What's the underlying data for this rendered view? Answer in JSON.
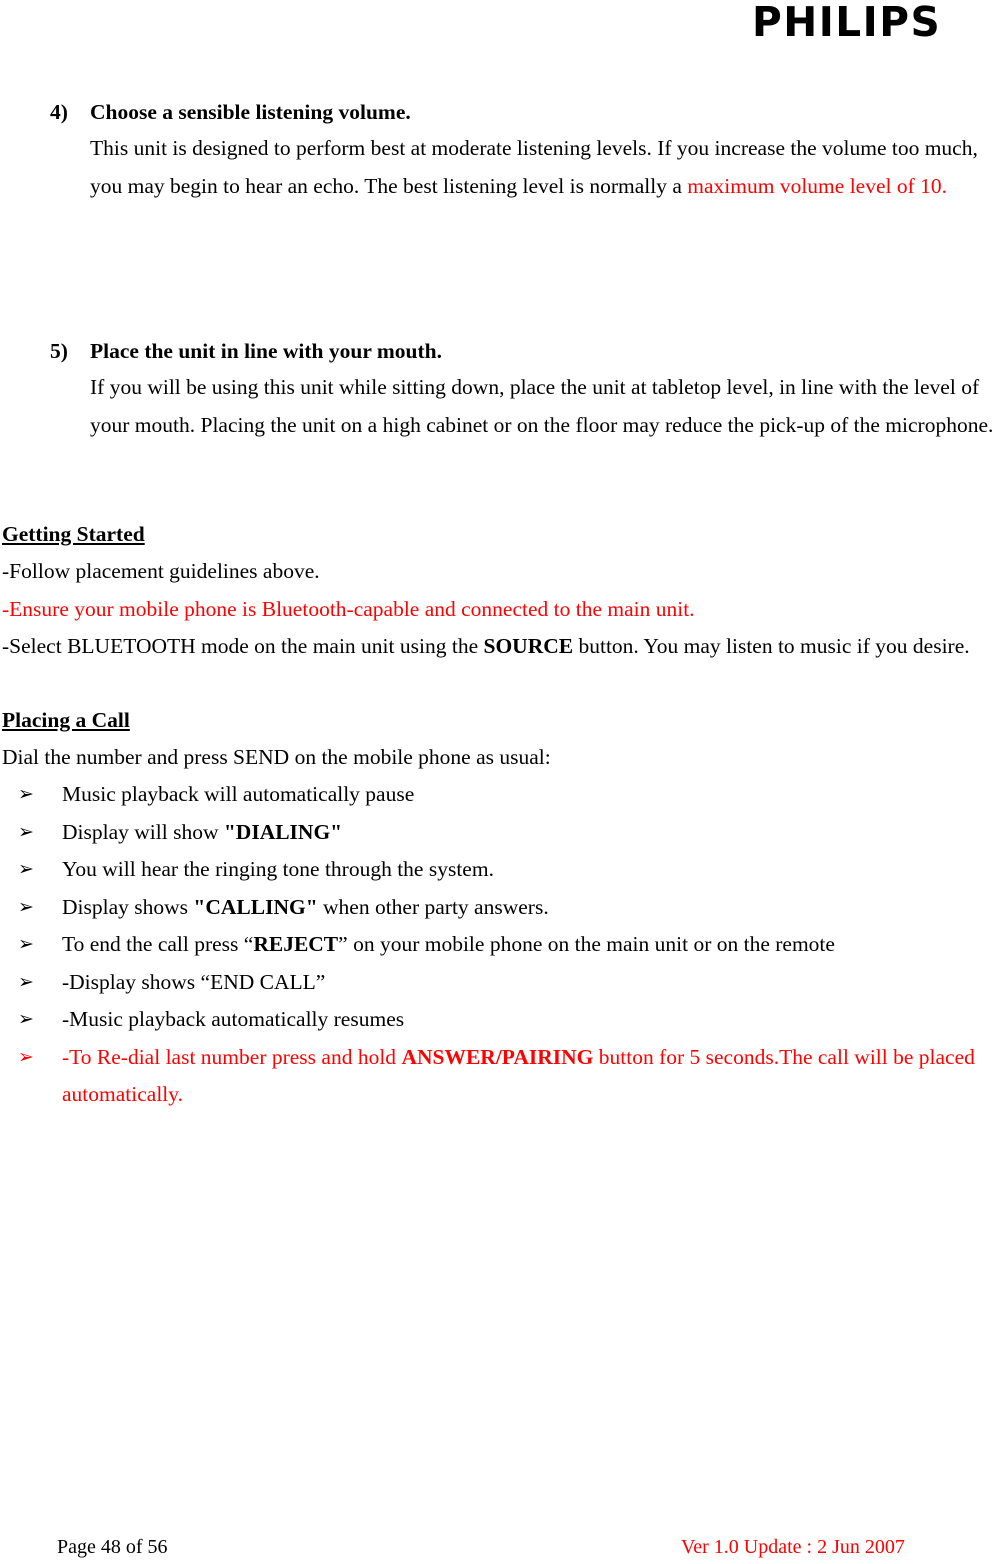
{
  "header": {
    "brand": "PHILIPS"
  },
  "colors": {
    "text": "#000000",
    "highlight": "#ff0000"
  },
  "numbered_items": [
    {
      "number": "4)",
      "heading": "Choose a sensible listening volume.",
      "body_black": "This unit is designed to perform best at moderate listening levels. If you increase the volume too much, you may begin to hear an echo. The best listening level is normally a ",
      "body_red": "maximum volume level of 10."
    },
    {
      "number": "5)",
      "heading": "Place the unit in line with your mouth.",
      "body_black": "If you will be using this unit while sitting down, place the unit at tabletop level, in line with the level of your mouth. Placing the unit on a high cabinet or on the floor may reduce the pick-up of the microphone.",
      "body_red": ""
    }
  ],
  "getting_started": {
    "heading": "Getting Started",
    "line1": "-Follow placement guidelines above.",
    "line2_red": "-Ensure your mobile phone is Bluetooth-capable and connected to the main unit.",
    "line3_pre": "-Select BLUETOOTH mode on the main unit using the ",
    "line3_bold": "SOURCE",
    "line3_post": " button. You may listen to music if you desire."
  },
  "placing_a_call": {
    "heading": "Placing a Call",
    "intro": "Dial the number and press SEND on the mobile phone as usual:",
    "bullet_marker": "arrow-bullet-icon",
    "bullet_glyph": "➢",
    "bullets": [
      {
        "pre": "Music playback will automatically pause",
        "bold": "",
        "post": "",
        "red": false
      },
      {
        "pre": "Display will show ",
        "bold": "\"DIALING\"",
        "post": "",
        "red": false
      },
      {
        "pre": "You will hear the ringing tone through the system.",
        "bold": "",
        "post": "",
        "red": false
      },
      {
        "pre": "Display shows ",
        "bold": "\"CALLING\"",
        "post": " when other party answers.",
        "red": false
      },
      {
        "pre": "To end the call press “",
        "bold": "REJECT",
        "post": "” on your mobile phone on the main unit or on the remote",
        "red": false
      },
      {
        "pre": "-Display shows “END CALL”",
        "bold": "",
        "post": "",
        "red": false
      },
      {
        "pre": "-Music playback automatically resumes",
        "bold": "",
        "post": "",
        "red": false
      },
      {
        "pre": "-To Re-dial last number press and hold ",
        "bold": "ANSWER/PAIRING",
        "post": " button for 5 seconds.The call will be placed automatically.",
        "red": true
      }
    ]
  },
  "footer": {
    "page": "Page 48 of 56",
    "version": "Ver 1.0    Update : 2 Jun 2007"
  }
}
